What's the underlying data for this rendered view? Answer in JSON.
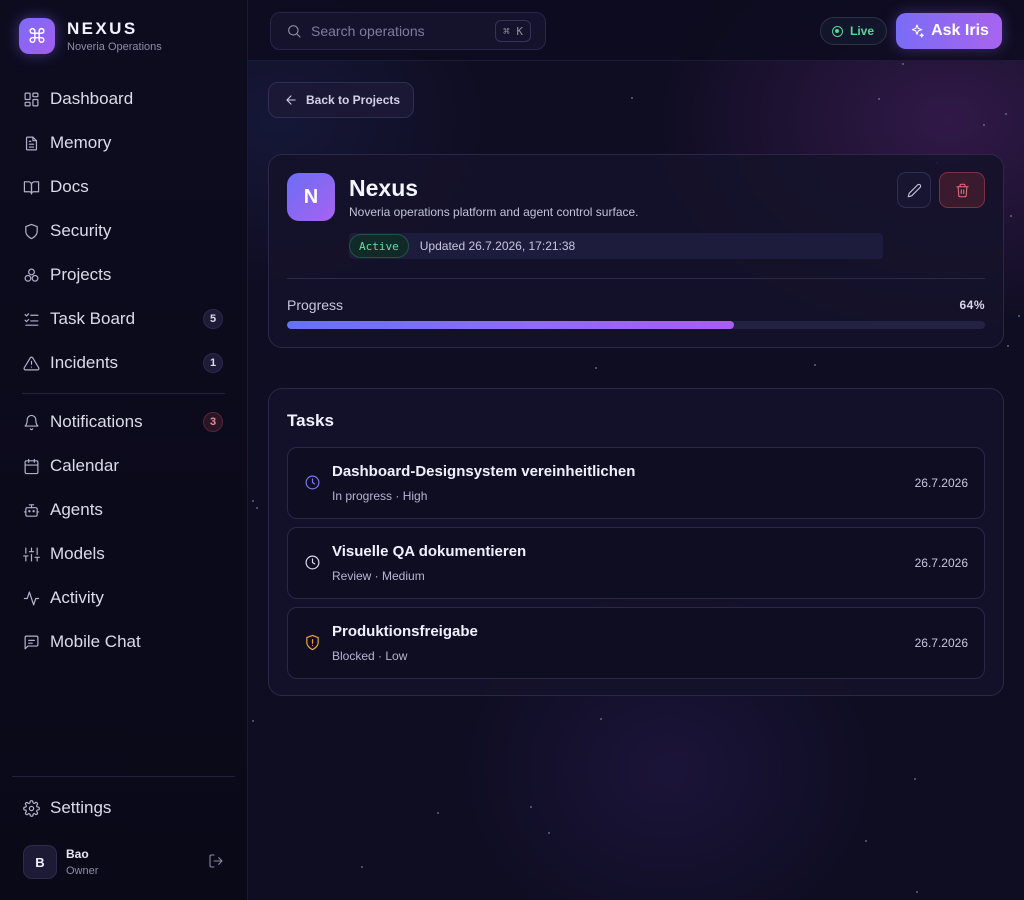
{
  "brand": {
    "title": "NEXUS",
    "subtitle": "Noveria Operations",
    "logo_icon": "command-icon"
  },
  "sidebar": {
    "items": [
      {
        "label": "Dashboard",
        "icon": "dashboard-icon"
      },
      {
        "label": "Memory",
        "icon": "document-icon"
      },
      {
        "label": "Docs",
        "icon": "book-icon"
      },
      {
        "label": "Security",
        "icon": "shield-icon"
      },
      {
        "label": "Projects",
        "icon": "projects-icon"
      },
      {
        "label": "Task Board",
        "icon": "checklist-icon",
        "badge": "5"
      },
      {
        "label": "Incidents",
        "icon": "warning-icon",
        "badge": "1"
      }
    ],
    "items2": [
      {
        "label": "Notifications",
        "icon": "bell-icon",
        "badge": "3"
      },
      {
        "label": "Calendar",
        "icon": "calendar-icon"
      },
      {
        "label": "Agents",
        "icon": "robot-icon"
      },
      {
        "label": "Models",
        "icon": "sliders-icon"
      },
      {
        "label": "Activity",
        "icon": "activity-icon"
      },
      {
        "label": "Mobile Chat",
        "icon": "chat-icon"
      }
    ],
    "settings_label": "Settings",
    "user": {
      "initial": "B",
      "name": "Bao",
      "role": "Owner"
    }
  },
  "topbar": {
    "search_placeholder": "Search operations",
    "search_shortcut": "⌘ K",
    "live_label": "Live",
    "ask_label": "Ask Iris"
  },
  "back_label": "Back to Projects",
  "project": {
    "initial": "N",
    "name": "Nexus",
    "description": "Noveria operations platform and agent control surface.",
    "status": "Active",
    "updated": "Updated 26.7.2026, 17:21:38",
    "progress_label": "Progress",
    "progress_text": "64%",
    "progress": 0.64
  },
  "tasks": {
    "title": "Tasks",
    "items": [
      {
        "name": "Dashboard-Designsystem vereinheitlichen",
        "meta": "In progress · High",
        "date": "26.7.2026",
        "icon": "clock-icon",
        "color": "#7b78f2"
      },
      {
        "name": "Visuelle QA dokumentieren",
        "meta": "Review · Medium",
        "date": "26.7.2026",
        "icon": "clock-icon",
        "color": "#dcd9ef"
      },
      {
        "name": "Produktionsfreigabe",
        "meta": "Blocked · Low",
        "date": "26.7.2026",
        "icon": "shield-alert-icon",
        "color": "#f0a13c"
      }
    ]
  },
  "colors": {
    "accent": "#8b6cf3",
    "live": "#56d69a",
    "danger": "#f0697f"
  }
}
